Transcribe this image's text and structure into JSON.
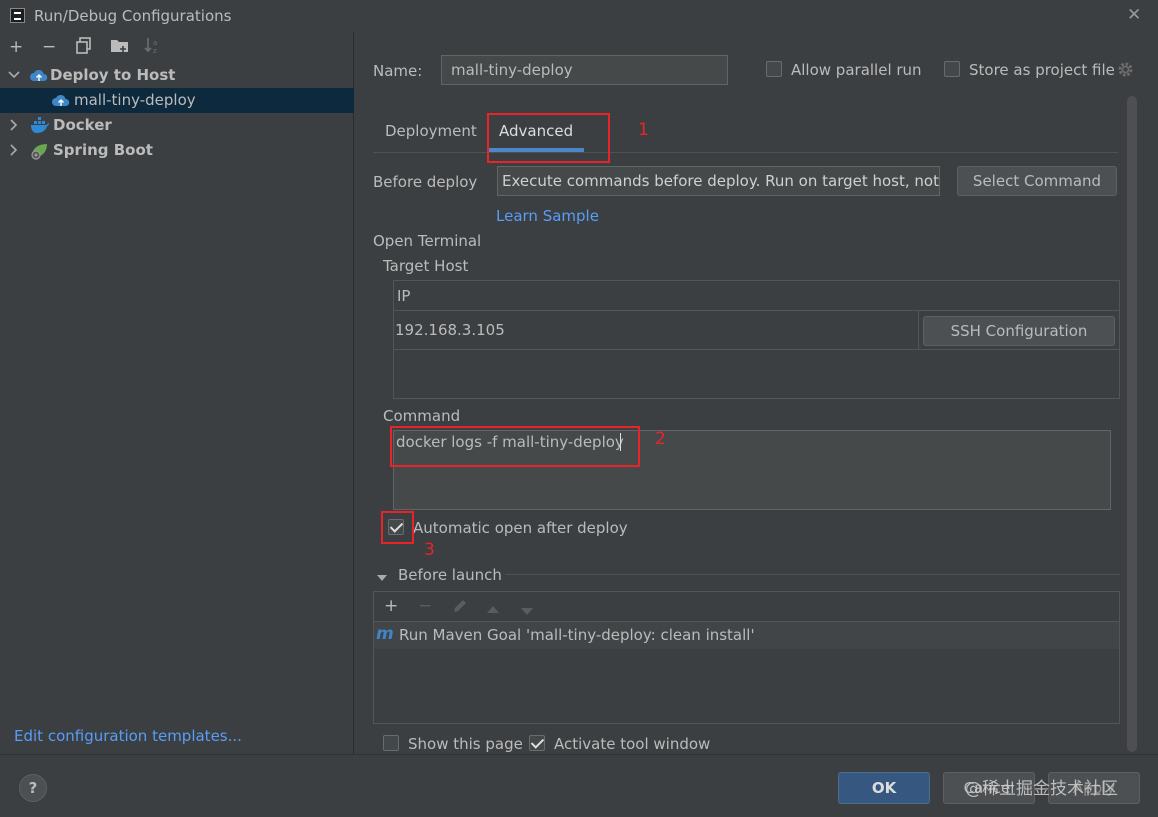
{
  "window": {
    "title": "Run/Debug Configurations",
    "close_glyph": "✕"
  },
  "left_toolbar": {
    "add": "+",
    "remove": "−",
    "copy": "⧉",
    "folder": "▰",
    "sort": "↓ᵃ"
  },
  "tree": {
    "items": [
      {
        "label": "Deploy to Host",
        "icon": "cloud-upload-icon",
        "expanded": true
      },
      {
        "label": "mall-tiny-deploy",
        "icon": "cloud-upload-icon",
        "selected": true
      },
      {
        "label": "Docker",
        "icon": "docker-icon",
        "expanded": false
      },
      {
        "label": "Spring Boot",
        "icon": "spring-boot-icon",
        "expanded": false
      }
    ]
  },
  "edit_templates": "Edit configuration templates...",
  "form": {
    "name_label": "Name:",
    "name_value": "mall-tiny-deploy",
    "allow_parallel_label": "Allow parallel run",
    "store_project_label": "Store as project file",
    "tabs": [
      "Deployment",
      "Advanced"
    ],
    "active_tab": "Advanced",
    "before_deploy_label": "Before deploy",
    "before_deploy_value": "Execute commands before deploy. Run on target host, not lc",
    "select_command": "Select Command",
    "learn_sample": "Learn Sample",
    "open_terminal_label": "Open Terminal",
    "target_host_label": "Target Host",
    "host_table_header": "IP",
    "host_ip": "192.168.3.105",
    "ssh_config": "SSH Configuration",
    "command_label": "Command",
    "command_value": "docker logs -f mall-tiny-deploy",
    "auto_open_label": "Automatic open after deploy",
    "before_launch_label": "Before launch",
    "before_launch_item": "Run Maven Goal 'mall-tiny-deploy: clean install'",
    "maven_glyph": "m",
    "show_page_label": "Show this page",
    "activate_tool_label": "Activate tool window"
  },
  "annotations": [
    "1",
    "2",
    "3"
  ],
  "buttons": {
    "ok": "OK",
    "cancel": "Cancel",
    "apply": "Apply",
    "help": "?"
  },
  "watermark": "@稀土掘金技术社区",
  "colors": {
    "background": "#3c3f41",
    "selection": "#0d293e",
    "link": "#589df6",
    "accent_tab": "#4a88c7",
    "annotation_red": "#e8242a",
    "primary_button": "#365880"
  }
}
